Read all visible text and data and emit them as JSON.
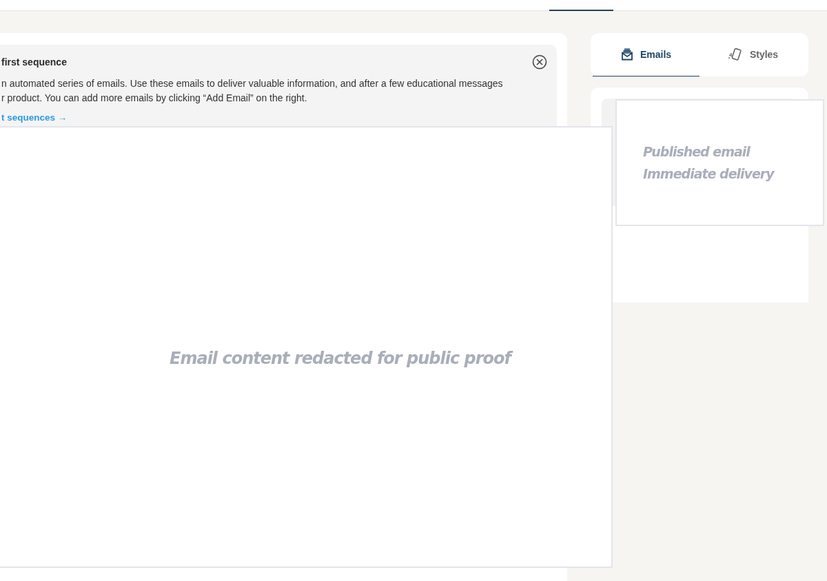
{
  "banner": {
    "title": "first sequence",
    "text": "n automated series of emails. Use these emails to deliver valuable information, and after a few educational messages\nr product. You can add more emails by clicking “Add Email” on the right.",
    "link": "t sequences →"
  },
  "tabs": [
    {
      "label": "Emails",
      "kind": "emails",
      "selected": true
    },
    {
      "label": "Styles",
      "kind": "styles",
      "selected": false
    }
  ],
  "redactions": [
    {
      "kind": "main",
      "lines": [
        "Email content redacted for public proof"
      ]
    },
    {
      "kind": "side",
      "lines": [
        "Published email",
        "Immediate delivery"
      ]
    }
  ]
}
